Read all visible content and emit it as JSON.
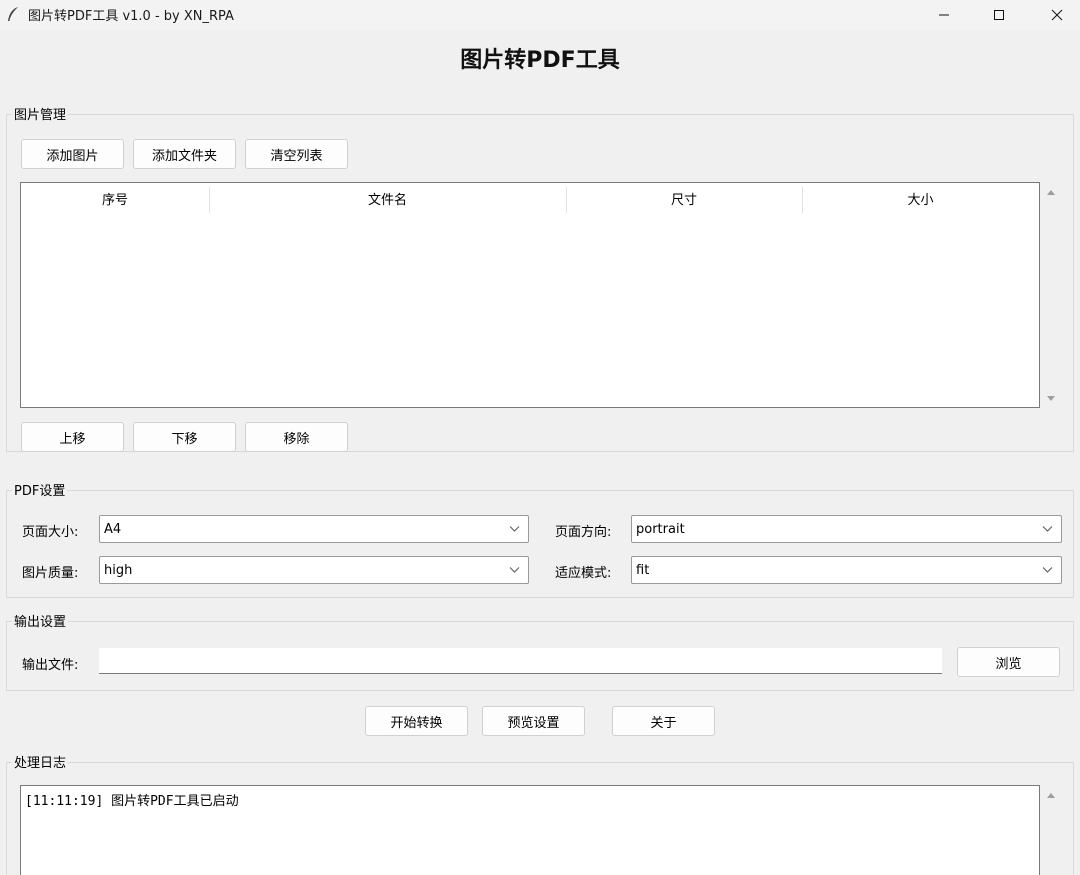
{
  "window": {
    "title": "图片转PDF工具 v1.0 - by XN_RPA"
  },
  "heading": "图片转PDF工具",
  "image_group": {
    "label": "图片管理",
    "buttons": {
      "add_image": "添加图片",
      "add_folder": "添加文件夹",
      "clear_list": "清空列表"
    },
    "columns": [
      "序号",
      "文件名",
      "尺寸",
      "大小"
    ],
    "rows": [],
    "row_buttons": {
      "move_up": "上移",
      "move_down": "下移",
      "remove": "移除"
    }
  },
  "pdf_group": {
    "label": "PDF设置",
    "page_size": {
      "label": "页面大小:",
      "value": "A4"
    },
    "orientation": {
      "label": "页面方向:",
      "value": "portrait"
    },
    "quality": {
      "label": "图片质量:",
      "value": "high"
    },
    "fit_mode": {
      "label": "适应模式:",
      "value": "fit"
    }
  },
  "output_group": {
    "label": "输出设置",
    "file_label": "输出文件:",
    "file_value": "",
    "browse": "浏览"
  },
  "actions": {
    "start": "开始转换",
    "preview": "预览设置",
    "about": "关于"
  },
  "log_group": {
    "label": "处理日志",
    "entries": [
      "[11:11:19] 图片转PDF工具已启动"
    ]
  }
}
